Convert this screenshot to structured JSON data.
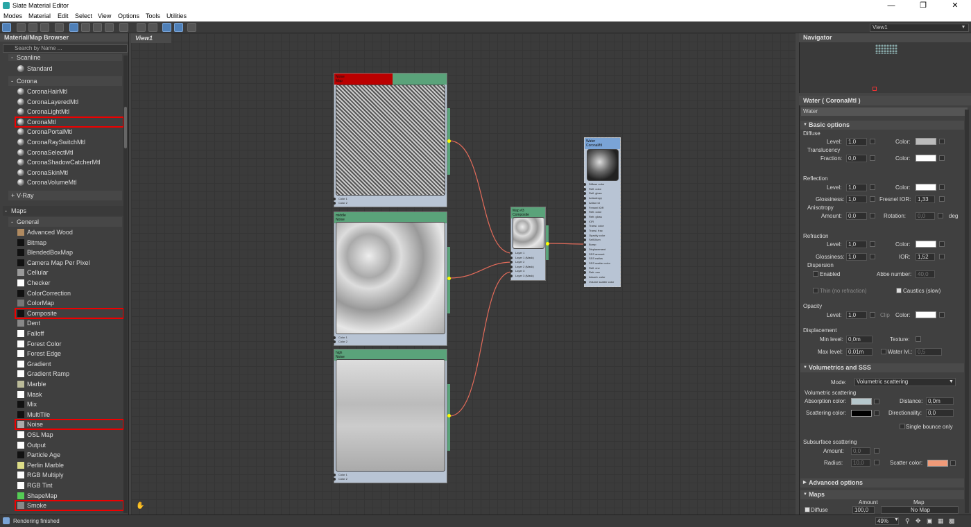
{
  "window": {
    "title": "Slate Material Editor"
  },
  "menu": [
    "Modes",
    "Material",
    "Edit",
    "Select",
    "View",
    "Options",
    "Tools",
    "Utilities"
  ],
  "view_select": "View1",
  "browser": {
    "title": "Material/Map Browser",
    "search_placeholder": "Search by Name ...",
    "scanline_label": "Scanline",
    "standard": "Standard",
    "corona_label": "Corona",
    "corona_items": [
      "CoronaHairMtl",
      "CoronaLayeredMtl",
      "CoronaLightMtl",
      "CoronaMtl",
      "CoronaPortalMtl",
      "CoronaRaySwitchMtl",
      "CoronaSelectMtl",
      "CoronaShadowCatcherMtl",
      "CoronaSkinMtl",
      "CoronaVolumeMtl"
    ],
    "vray_label": "V-Ray",
    "maps_label": "Maps",
    "general_label": "General",
    "map_items": [
      "Advanced Wood",
      "Bitmap",
      "BlendedBoxMap",
      "Camera Map Per Pixel",
      "Cellular",
      "Checker",
      "ColorCorrection",
      "ColorMap",
      "Composite",
      "Dent",
      "Falloff",
      "Forest Color",
      "Forest Edge",
      "Gradient",
      "Gradient Ramp",
      "Marble",
      "Mask",
      "Mix",
      "MultiTile",
      "Noise",
      "OSL Map",
      "Output",
      "Particle Age",
      "Perlin Marble",
      "RGB Multiply",
      "RGB Tint",
      "ShapeMap",
      "Smoke"
    ]
  },
  "view": {
    "tab": "View1"
  },
  "nodes": {
    "n1": {
      "title": "Noise",
      "sub": "Map",
      "slots": [
        "Color 1",
        "Color 2"
      ]
    },
    "n2": {
      "title": "middle",
      "sub": "Noise",
      "slots": [
        "Color 1",
        "Color 2"
      ]
    },
    "n3": {
      "title": "high",
      "sub": "Noise",
      "slots": [
        "Color 1",
        "Color 2"
      ]
    },
    "comp": {
      "title": "Map #3",
      "sub": "Composite",
      "slots": [
        "Layer 1",
        "Layer 1 (Mask)",
        "Layer 2",
        "Layer 2 (Mask)",
        "Layer 3",
        "Layer 3 (Mask)"
      ]
    },
    "water": {
      "title": "Water",
      "sub": "CoronaMtl",
      "slots": [
        "Diffuse color",
        "Refl. color",
        "Refl. gloss",
        "Anisotropy",
        "Aniso rot",
        "Fresnel IOR",
        "Refr. color",
        "Refr. gloss",
        "IOR",
        "Transl. color",
        "Transl. frac",
        "Opacity color",
        "Self-Illum",
        "Bump",
        "Displacement",
        "SSS amount",
        "SSS radius",
        "SSS scatter color",
        "Refl. env",
        "Refr. env",
        "Absorb. color",
        "Volume scatter color"
      ]
    }
  },
  "navigator": {
    "title": "Navigator"
  },
  "props": {
    "title": "Water  ( CoronaMtl )",
    "name": "Water",
    "basic": "Basic options",
    "diffuse": "Diffuse",
    "level": "Level:",
    "level_v": "1,0",
    "color": "Color:",
    "translucency": "Translucency",
    "fraction": "Fraction:",
    "fraction_v": "0,0",
    "reflection": "Reflection",
    "refl_level_v": "1,0",
    "glossiness": "Glossiness:",
    "gloss_v": "1,0",
    "fresnel": "Fresnel IOR:",
    "fresnel_v": "1,33",
    "anisotropy": "Anisotropy",
    "amount": "Amount:",
    "amount_v": "0,0",
    "rotation": "Rotation:",
    "rotation_v": "0,0",
    "deg": "deg",
    "refraction": "Refraction",
    "refr_level_v": "1,0",
    "refr_gloss_v": "1,0",
    "ior": "IOR:",
    "ior_v": "1,52",
    "dispersion": "Dispersion",
    "enabled": "Enabled",
    "abbe": "Abbe number:",
    "abbe_v": "40,0",
    "thin": "Thin (no refraction)",
    "caustics": "Caustics (slow)",
    "opacity": "Opacity",
    "op_level_v": "1,0",
    "clip": "Clip",
    "displacement": "Displacement",
    "min_level": "Min level:",
    "min_v": "0,0m",
    "texture": "Texture:",
    "max_level": "Max level:",
    "max_v": "0,01m",
    "water_lvl": "Water lvl.:",
    "water_v": "0,5",
    "vol": "Volumetrics and SSS",
    "mode": "Mode:",
    "mode_v": "Volumetric scattering",
    "vol_scat": "Volumetric scattering",
    "absorption": "Absorption color:",
    "distance": "Distance:",
    "distance_v": "0,0m",
    "scattering": "Scattering color:",
    "directionality": "Directionality:",
    "dir_v": "0,0",
    "single": "Single bounce only",
    "sss": "Subsurface scattering",
    "sss_amount_v": "0,0",
    "radius": "Radius:",
    "radius_v": "10,0",
    "scatter_color": "Scatter color:",
    "advanced": "Advanced options",
    "maps": "Maps",
    "maps_amount": "Amount",
    "maps_map": "Map",
    "maps_diffuse": "Diffuse",
    "maps_diffuse_v": "100,0",
    "nomap": "No Map"
  },
  "status": {
    "text": "Rendering finished",
    "zoom": "49%"
  }
}
